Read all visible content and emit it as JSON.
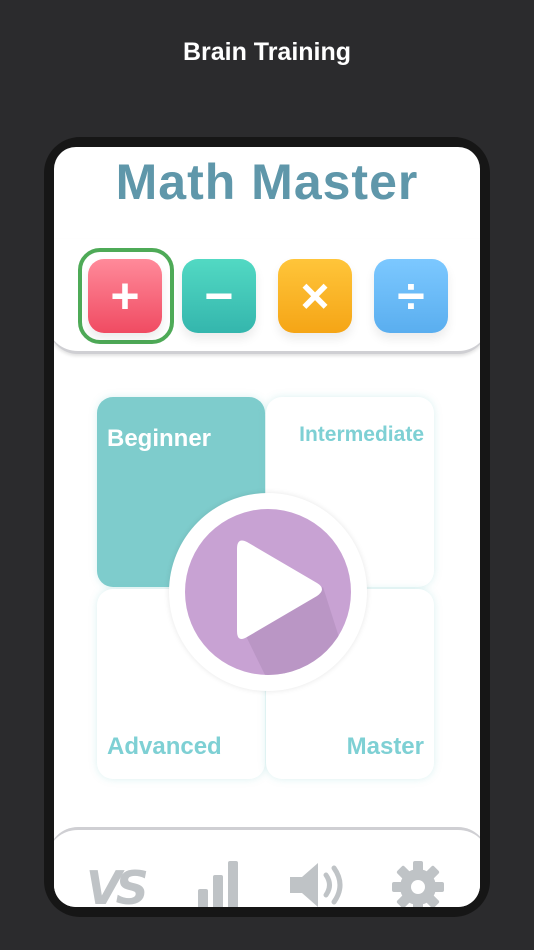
{
  "header": {
    "title": "Brain Training"
  },
  "app": {
    "title": "Math Master",
    "operations": [
      {
        "name": "addition",
        "symbol": "+",
        "selected": true
      },
      {
        "name": "subtraction",
        "symbol": "−",
        "selected": false
      },
      {
        "name": "multiplication",
        "symbol": "×",
        "selected": false
      },
      {
        "name": "division",
        "symbol": "÷",
        "selected": false
      }
    ],
    "levels": [
      {
        "label": "Beginner",
        "selected": true
      },
      {
        "label": "Intermediate",
        "selected": false
      },
      {
        "label": "Advanced",
        "selected": false
      },
      {
        "label": "Master",
        "selected": false
      }
    ],
    "tab_bar": {
      "vs_label": "VS",
      "icons": [
        "versus-icon",
        "bar-chart-icon",
        "speaker-icon",
        "gear-icon"
      ]
    }
  },
  "colors": {
    "background": "#2b2b2d",
    "title": "#5f97aa",
    "beginner": "#7ecccc",
    "play": "#c8a2d3",
    "selection_ring": "#4eaa57"
  }
}
